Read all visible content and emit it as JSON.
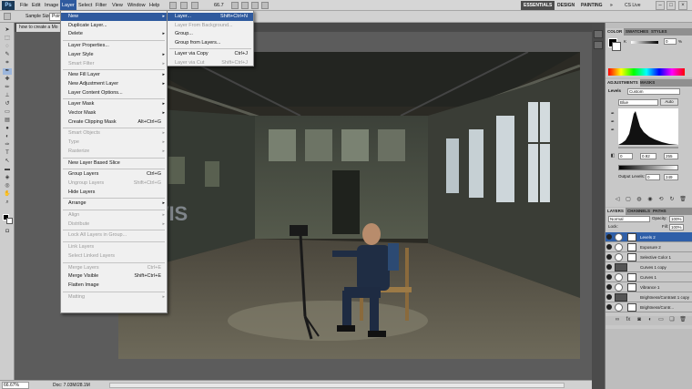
{
  "menubar": {
    "logo": "Ps",
    "items": [
      "File",
      "Edit",
      "Image",
      "Layer",
      "Select",
      "Filter",
      "View",
      "Window",
      "Help"
    ],
    "zoom": "66.7",
    "workspaces": [
      "ESSENTIALS",
      "DESIGN",
      "PAINTING"
    ],
    "more": "»",
    "cs_live": "CS Live"
  },
  "optbar": {
    "sample_label": "Sample Size:",
    "sample_value": "Point"
  },
  "doc_tab": "how to create a Mo",
  "status": {
    "zoom": "66.67%",
    "doc_size": "Doc: 7.03M/28.1M"
  },
  "layer_menu": {
    "items": [
      {
        "label": "New",
        "shortcut": "",
        "arrow": true,
        "disabled": false,
        "hl": true
      },
      {
        "label": "Duplicate Layer...",
        "shortcut": "",
        "arrow": false,
        "disabled": false
      },
      {
        "label": "Delete",
        "shortcut": "",
        "arrow": true,
        "disabled": false
      },
      {
        "label": "Layer Properties...",
        "shortcut": "",
        "arrow": false,
        "disabled": false
      },
      {
        "label": "Layer Style",
        "shortcut": "",
        "arrow": true,
        "disabled": false
      },
      {
        "label": "Smart Filter",
        "shortcut": "",
        "arrow": true,
        "disabled": true
      },
      {
        "label": "New Fill Layer",
        "shortcut": "",
        "arrow": true,
        "disabled": false
      },
      {
        "label": "New Adjustment Layer",
        "shortcut": "",
        "arrow": true,
        "disabled": false
      },
      {
        "label": "Layer Content Options...",
        "shortcut": "",
        "arrow": false,
        "disabled": false
      },
      {
        "label": "Layer Mask",
        "shortcut": "",
        "arrow": true,
        "disabled": false
      },
      {
        "label": "Vector Mask",
        "shortcut": "",
        "arrow": true,
        "disabled": false
      },
      {
        "label": "Create Clipping Mask",
        "shortcut": "Alt+Ctrl+G",
        "arrow": false,
        "disabled": false
      },
      {
        "label": "Smart Objects",
        "shortcut": "",
        "arrow": true,
        "disabled": true
      },
      {
        "label": "Type",
        "shortcut": "",
        "arrow": true,
        "disabled": true
      },
      {
        "label": "Rasterize",
        "shortcut": "",
        "arrow": true,
        "disabled": true
      },
      {
        "label": "New Layer Based Slice",
        "shortcut": "",
        "arrow": false,
        "disabled": false
      },
      {
        "label": "Group Layers",
        "shortcut": "Ctrl+G",
        "arrow": false,
        "disabled": false
      },
      {
        "label": "Ungroup Layers",
        "shortcut": "Shift+Ctrl+G",
        "arrow": false,
        "disabled": true
      },
      {
        "label": "Hide Layers",
        "shortcut": "",
        "arrow": false,
        "disabled": false
      },
      {
        "label": "Arrange",
        "shortcut": "",
        "arrow": true,
        "disabled": false
      },
      {
        "label": "Align",
        "shortcut": "",
        "arrow": true,
        "disabled": true
      },
      {
        "label": "Distribute",
        "shortcut": "",
        "arrow": true,
        "disabled": true
      },
      {
        "label": "Lock All Layers in Group...",
        "shortcut": "",
        "arrow": false,
        "disabled": true
      },
      {
        "label": "Link Layers",
        "shortcut": "",
        "arrow": false,
        "disabled": true
      },
      {
        "label": "Select Linked Layers",
        "shortcut": "",
        "arrow": false,
        "disabled": true
      },
      {
        "label": "Merge Layers",
        "shortcut": "Ctrl+E",
        "arrow": false,
        "disabled": true
      },
      {
        "label": "Merge Visible",
        "shortcut": "Shift+Ctrl+E",
        "arrow": false,
        "disabled": false
      },
      {
        "label": "Flatten Image",
        "shortcut": "",
        "arrow": false,
        "disabled": false
      },
      {
        "label": "Matting",
        "shortcut": "",
        "arrow": true,
        "disabled": true
      }
    ]
  },
  "new_submenu": {
    "items": [
      {
        "label": "Layer...",
        "shortcut": "Shift+Ctrl+N",
        "disabled": false,
        "hl": true
      },
      {
        "label": "Layer From Background...",
        "shortcut": "",
        "disabled": true
      },
      {
        "label": "Group...",
        "shortcut": "",
        "disabled": false
      },
      {
        "label": "Group from Layers...",
        "shortcut": "",
        "disabled": false
      },
      {
        "label": "Layer via Copy",
        "shortcut": "Ctrl+J",
        "disabled": false
      },
      {
        "label": "Layer via Cut",
        "shortcut": "Shift+Ctrl+J",
        "disabled": true
      }
    ]
  },
  "color_panel": {
    "tabs": [
      "COLOR",
      "SWATCHES",
      "STYLES"
    ],
    "k_label": "K",
    "k_value": "0",
    "k_unit": "%"
  },
  "adjustments": {
    "tabs": [
      "ADJUSTMENTS",
      "MASKS"
    ],
    "title": "Levels",
    "preset": "Custom",
    "channel": "Blue",
    "auto": "Auto",
    "input_values": [
      "0",
      "0.92",
      "255"
    ],
    "output_label": "Output Levels:",
    "output_values": [
      "0",
      "249"
    ]
  },
  "layers": {
    "tabs": [
      "LAYERS",
      "CHANNELS",
      "PATHS"
    ],
    "blend": "Normal",
    "opacity_label": "Opacity:",
    "opacity": "100%",
    "lock_label": "Lock:",
    "fill_label": "Fill:",
    "fill": "100%",
    "rows": [
      {
        "name": "Levels 2",
        "type": "adj",
        "selected": true
      },
      {
        "name": "Exposure 2",
        "type": "adj",
        "selected": false
      },
      {
        "name": "Selective Color 1",
        "type": "adj",
        "selected": false
      },
      {
        "name": "Curves 1 copy",
        "type": "img",
        "selected": false
      },
      {
        "name": "Curves 1",
        "type": "adj",
        "selected": false
      },
      {
        "name": "Vibrance 1",
        "type": "adj",
        "selected": false
      },
      {
        "name": "Brightness/Contrast 1 copy",
        "type": "img",
        "selected": false
      },
      {
        "name": "Brightness/Contr...",
        "type": "adj",
        "selected": false
      }
    ]
  },
  "colors": {
    "accent": "#2f5a9e",
    "selected_layer": "#2f5fa8"
  }
}
